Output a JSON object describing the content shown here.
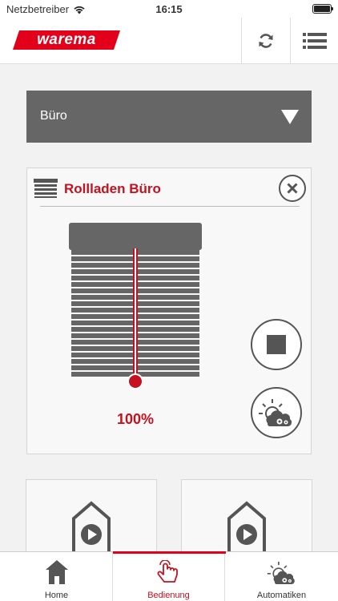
{
  "statusbar": {
    "carrier": "Netzbetreiber",
    "time": "16:15"
  },
  "brand": {
    "logo_text": "warema",
    "accent": "#e2001a",
    "title_red": "#c5111f",
    "dark_gray": "#666666"
  },
  "room_select": {
    "selected": "Büro"
  },
  "device": {
    "title": "Rollladen Büro",
    "position_percent": 100,
    "position_label": "100%"
  },
  "icons": {
    "wifi": "wifi-icon",
    "sync": "sync-icon",
    "menu": "menu-icon",
    "dropdown": "triangle-down-icon",
    "device": "shutter-icon",
    "close": "close-icon",
    "stop": "stop-icon",
    "automatic": "sun-cloud-gear-icon",
    "scene": "house-play-icon",
    "home": "home-icon",
    "bedienung": "hand-tap-icon"
  },
  "nav": {
    "items": [
      {
        "label": "Home"
      },
      {
        "label": "Bedienung"
      },
      {
        "label": "Automatiken"
      }
    ],
    "active": "Bedienung"
  }
}
